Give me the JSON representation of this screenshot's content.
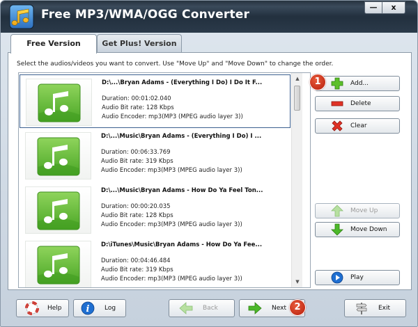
{
  "window": {
    "title": "Free MP3/WMA/OGG Converter",
    "minimize_label": "—",
    "close_label": "x"
  },
  "tabs": [
    {
      "label": "Free Version",
      "active": true
    },
    {
      "label": "Get Plus! Version",
      "active": false
    }
  ],
  "instruction": "Select the audios/videos you want to convert. Use \"Move Up\" and \"Move Down\" to change the order.",
  "files": [
    {
      "path": "D:\\...\\Bryan Adams - (Everything I Do) I Do It F...",
      "duration": "Duration: 00:01:02.040",
      "bitrate": "Audio Bit rate: 128 Kbps",
      "encoder": "Audio Encoder: mp3(MP3 (MPEG audio layer 3))",
      "selected": true
    },
    {
      "path": "D:\\...\\Music\\Bryan Adams - (Everything I Do) I ...",
      "duration": "Duration: 00:06:33.769",
      "bitrate": "Audio Bit rate: 319 Kbps",
      "encoder": "Audio Encoder: mp3(MP3 (MPEG audio layer 3))",
      "selected": false
    },
    {
      "path": "D:\\...\\Music\\Bryan Adams - How Do Ya Feel Ton...",
      "duration": "Duration: 00:00:20.035",
      "bitrate": "Audio Bit rate: 128 Kbps",
      "encoder": "Audio Encoder: mp3(MP3 (MPEG audio layer 3))",
      "selected": false
    },
    {
      "path": "D:\\iTunes\\Music\\Bryan Adams - How Do Ya Fee...",
      "duration": "Duration: 00:04:46.484",
      "bitrate": "Audio Bit rate: 319 Kbps",
      "encoder": "Audio Encoder: mp3(MP3 (MPEG audio layer 3))",
      "selected": false
    }
  ],
  "side_buttons": {
    "add": "Add...",
    "delete": "Delete",
    "clear": "Clear",
    "move_up": "Move Up",
    "move_down": "Move Down",
    "play": "Play"
  },
  "badges": {
    "one": "1",
    "two": "2"
  },
  "bottom_buttons": {
    "help": "Help",
    "log": "Log",
    "back": "Back",
    "next": "Next",
    "exit": "Exit"
  },
  "colors": {
    "title_bar": "#2b3a4a",
    "badge": "#c8280f",
    "green_icon": "#6cc13a",
    "red_icon": "#d8281e",
    "blue_icon": "#1f6fd1"
  }
}
